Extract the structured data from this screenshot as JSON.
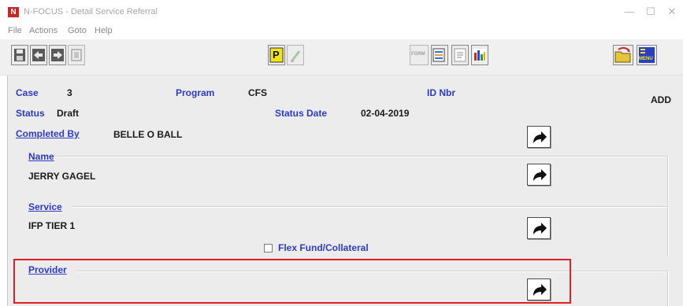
{
  "window": {
    "title": "N-FOCUS - Detail Service Referral",
    "app_icon_letter": "N",
    "controls": {
      "minimize": "—",
      "maximize": "☐",
      "close": "✕"
    }
  },
  "menu": [
    "File",
    "Actions",
    "Goto",
    "Help"
  ],
  "toolbar": {
    "buttons": [
      "save-icon",
      "previous-icon",
      "next-icon",
      "disabled-icon",
      "program-p-icon",
      "disabled-pencil-icon",
      "form-icon",
      "list-icon",
      "report-icon",
      "bar-chart-icon",
      "folder-icon",
      "menu-icon"
    ],
    "p_label": "P",
    "form_label": "FORM",
    "menu_label": "MENU"
  },
  "header": {
    "case_label": "Case",
    "case_value": "3",
    "program_label": "Program",
    "program_value": "CFS",
    "id_label": "ID Nbr",
    "id_value": "",
    "mode": "ADD",
    "status_label": "Status",
    "status_value": "Draft",
    "status_date_label": "Status Date",
    "status_date_value": "02-04-2019",
    "completed_by_label": "Completed By",
    "completed_by_value": "BELLE O BALL"
  },
  "sections": {
    "name_label": "Name",
    "name_value": "JERRY GAGEL",
    "service_label": "Service",
    "service_value": "IFP TIER 1",
    "flex_fund_label": "Flex Fund/Collateral",
    "flex_fund_checked": false,
    "provider_label": "Provider",
    "provider_value": ""
  },
  "colors": {
    "label_blue": "#2d3ac4",
    "highlight_red": "#e01f26",
    "panel_gray": "#ececec"
  }
}
